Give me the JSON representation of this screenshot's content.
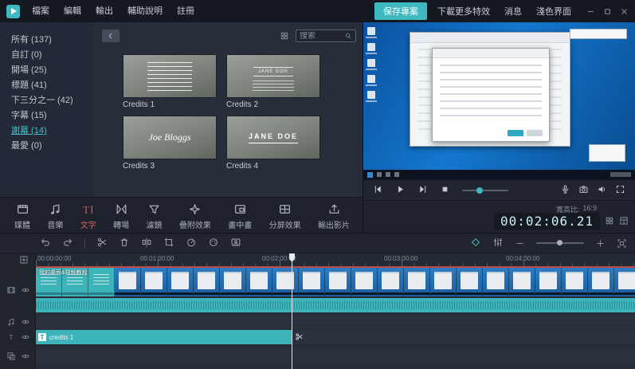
{
  "app": {
    "accent": "#3fb9c0",
    "danger": "#e0595c"
  },
  "menubar": {
    "menus": [
      {
        "label": "檔案"
      },
      {
        "label": "編輯"
      },
      {
        "label": "輸出"
      },
      {
        "label": "輔助說明"
      },
      {
        "label": "註冊"
      }
    ],
    "actions": [
      {
        "label": "保存專案",
        "highlight": true
      },
      {
        "label": "下載更多特效"
      },
      {
        "label": "消息"
      },
      {
        "label": "淺色界面"
      }
    ],
    "window_icons": {
      "minimize": "win-min",
      "maximize": "win-max",
      "close": "win-close"
    }
  },
  "sidebar": {
    "items": [
      {
        "label": "所有 (137)"
      },
      {
        "label": "自訂 (0)"
      },
      {
        "label": "開場 (25)"
      },
      {
        "label": "標題 (41)"
      },
      {
        "label": "下三分之一 (42)"
      },
      {
        "label": "字幕 (15)"
      },
      {
        "label": "謝幕 (14)",
        "selected": true
      },
      {
        "label": "最愛 (0)"
      }
    ]
  },
  "library": {
    "back_icon": "back",
    "view_icon": "grid",
    "search": {
      "placeholder": "搜索",
      "icon": "search"
    },
    "templates": [
      {
        "name": "Credits 1",
        "preview": ""
      },
      {
        "name": "Credits 2",
        "preview": "JANE DOE"
      },
      {
        "name": "Credits 3",
        "preview": "Joe Bloggs"
      },
      {
        "name": "Credits 4",
        "preview": "JANE DOE"
      }
    ]
  },
  "modes": [
    {
      "label": "媒體",
      "icon": "media"
    },
    {
      "label": "音樂",
      "icon": "music"
    },
    {
      "label": "文字",
      "icon": "text-ti",
      "active": true
    },
    {
      "label": "轉場",
      "icon": "transition"
    },
    {
      "label": "濾鏡",
      "icon": "filter"
    },
    {
      "label": "疊附效果",
      "icon": "overlay"
    },
    {
      "label": "畫中畫",
      "icon": "pip"
    },
    {
      "label": "分屏效果",
      "icon": "splitscreen"
    },
    {
      "label": "輸出影片",
      "icon": "export"
    }
  ],
  "transport": {
    "left_icons": [
      "skip-start",
      "play",
      "skip-end",
      "stop"
    ],
    "right_icons": [
      "mic",
      "camera",
      "speaker",
      "fullscreen"
    ]
  },
  "status": {
    "aspect_label": "寬高比:",
    "aspect_value": "16:9",
    "timecode": "00:02:06.21",
    "side_icons": [
      "grid",
      "layout"
    ]
  },
  "timeline": {
    "toolbar": {
      "history_icons": [
        "undo",
        "redo"
      ],
      "edit_icons": [
        "scissors",
        "trash",
        "split",
        "crop",
        "speed",
        "palette",
        "chroma"
      ],
      "right_icons": [
        "keyframe",
        "mixer"
      ],
      "zoom": {
        "out_icon": "minus",
        "in_icon": "plus",
        "fit_icon": "fit"
      }
    },
    "ruler_labels": [
      "00:00:00:00",
      "00:01:00:00",
      "00:02:00:00",
      "00:03:00:00",
      "00:04:00:00"
    ],
    "add_track_icon": "add-track",
    "tracks": [
      {
        "type": "video",
        "icon": "film-frame",
        "eye": "eye"
      },
      {
        "type": "music",
        "icon": "music",
        "eye": "eye"
      },
      {
        "type": "text",
        "icon": "text-track",
        "eye": "eye"
      },
      {
        "type": "pip",
        "icon": "pip-track",
        "eye": "eye"
      }
    ],
    "video_clip": {
      "label": "我的桌面&视频教程"
    },
    "text_clip": {
      "badge": "T",
      "label": "credits 1"
    },
    "split_icon": "scissors"
  }
}
